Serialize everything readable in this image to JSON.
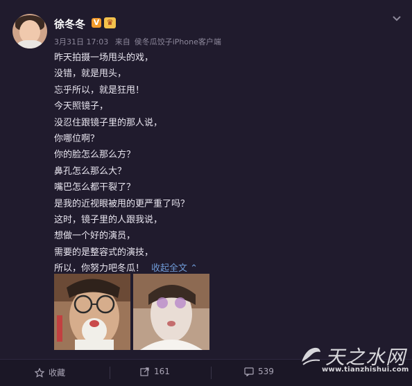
{
  "header": {
    "name": "徐冬冬",
    "vip_badge": "V",
    "member_badge": "♛"
  },
  "meta": {
    "date": "3月31日 17:03",
    "from_label": "来自",
    "source": "侯冬瓜饺子iPhone客户端"
  },
  "post_lines": [
    "昨天拍摄一场甩头的戏，",
    "没错，就是甩头，",
    "忘乎所以，就是狂甩！",
    "今天照镜子，",
    "没忍住跟镜子里的那人说，",
    "你哪位啊？",
    "你的脸怎么那么方？",
    "鼻孔怎么那么大？",
    "嘴巴怎么都干裂了？",
    "是我的近视眼被甩的更严重了吗？",
    "这时，镜子里的人跟我说，",
    "想做一个好的演员，",
    "需要的是整容式的演技，",
    "所以，你努力吧冬瓜！"
  ],
  "collapse_label": "收起全文 ⌃",
  "actions": {
    "favorite": "收藏",
    "repost_count": "161",
    "comment_count": "539"
  },
  "watermark": {
    "title": "天之水网",
    "url": "www.tianzhishui.com"
  },
  "colors": {
    "background": "#201b2d",
    "link": "#6f9ad6",
    "badge_orange": "#f29b2c",
    "badge_gold": "#f3c24c"
  }
}
